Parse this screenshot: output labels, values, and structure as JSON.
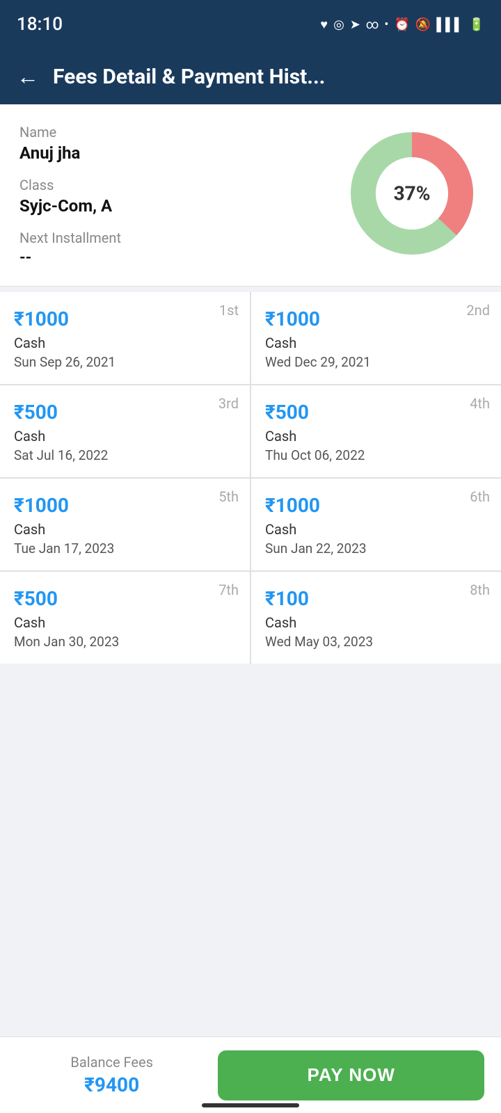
{
  "statusBar": {
    "time": "18:10",
    "icons": "♥ ◎ ➤ ∞ • ⏰ 🔕 ⟳ 📶 🔋"
  },
  "header": {
    "title": "Fees Detail & Payment Hist...",
    "backLabel": "←"
  },
  "profile": {
    "nameLabel": "Name",
    "nameValue": "Anuj jha",
    "classLabel": "Class",
    "classValue": "Syjc-Com, A",
    "nextInstallmentLabel": "Next Installment",
    "nextInstallmentValue": "--",
    "chartPercent": "37%",
    "paidPercent": 37,
    "unpaidPercent": 63
  },
  "payments": [
    {
      "installment": "1st",
      "amount": "₹1000",
      "method": "Cash",
      "date": "Sun Sep 26, 2021"
    },
    {
      "installment": "2nd",
      "amount": "₹1000",
      "method": "Cash",
      "date": "Wed Dec 29, 2021"
    },
    {
      "installment": "3rd",
      "amount": "₹500",
      "method": "Cash",
      "date": "Sat Jul 16, 2022"
    },
    {
      "installment": "4th",
      "amount": "₹500",
      "method": "Cash",
      "date": "Thu Oct 06, 2022"
    },
    {
      "installment": "5th",
      "amount": "₹1000",
      "method": "Cash",
      "date": "Tue Jan 17, 2023"
    },
    {
      "installment": "6th",
      "amount": "₹1000",
      "method": "Cash",
      "date": "Sun Jan 22, 2023"
    },
    {
      "installment": "7th",
      "amount": "₹500",
      "method": "Cash",
      "date": "Mon Jan 30, 2023"
    },
    {
      "installment": "8th",
      "amount": "₹100",
      "method": "Cash",
      "date": "Wed May 03, 2023"
    }
  ],
  "bottomBar": {
    "balanceLabel": "Balance Fees",
    "balanceAmount": "₹9400",
    "payNowLabel": "PAY NOW"
  },
  "colors": {
    "paid": "#f08080",
    "unpaid": "#a8d8a8",
    "accent": "#2196F3",
    "headerBg": "#1a3a5c",
    "payNow": "#4CAF50"
  }
}
